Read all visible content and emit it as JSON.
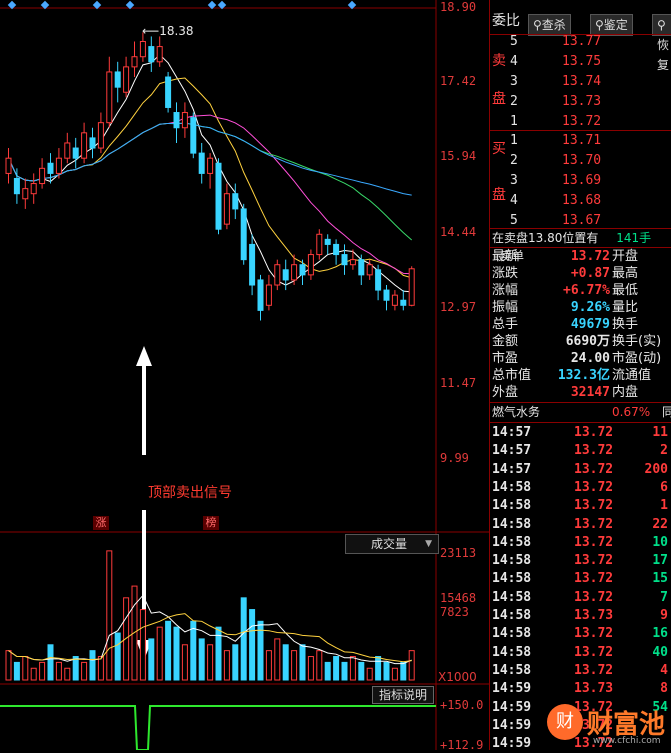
{
  "chart": {
    "price_ticks": [
      "18.90",
      "17.42",
      "15.94",
      "14.44",
      "12.97",
      "11.47",
      "9.99"
    ],
    "high_marker": "18.38",
    "signal_text": "顶部卖出信号",
    "tags": [
      "涨",
      "榜"
    ],
    "volume_dropdown": "成交量",
    "volume_ticks": [
      "23113",
      "15468",
      "7823"
    ],
    "volume_unit": "X1000",
    "indicator_button": "指标说明",
    "indicator_ticks": [
      "+150.0",
      "+112.9"
    ]
  },
  "chart_data": {
    "type": "candlestick",
    "ylim": [
      9.99,
      18.9
    ],
    "candles": [
      {
        "o": 15.6,
        "c": 15.9,
        "h": 16.1,
        "l": 15.4
      },
      {
        "o": 15.5,
        "c": 15.2,
        "h": 15.7,
        "l": 15.0
      },
      {
        "o": 15.1,
        "c": 15.3,
        "h": 15.5,
        "l": 14.9
      },
      {
        "o": 15.2,
        "c": 15.4,
        "h": 15.6,
        "l": 15.0
      },
      {
        "o": 15.4,
        "c": 15.7,
        "h": 15.9,
        "l": 15.3
      },
      {
        "o": 15.8,
        "c": 15.6,
        "h": 16.0,
        "l": 15.4
      },
      {
        "o": 15.6,
        "c": 15.9,
        "h": 16.1,
        "l": 15.5
      },
      {
        "o": 15.9,
        "c": 16.2,
        "h": 16.4,
        "l": 15.8
      },
      {
        "o": 16.1,
        "c": 15.9,
        "h": 16.3,
        "l": 15.7
      },
      {
        "o": 15.9,
        "c": 16.4,
        "h": 16.6,
        "l": 15.8
      },
      {
        "o": 16.3,
        "c": 16.1,
        "h": 16.5,
        "l": 15.9
      },
      {
        "o": 16.1,
        "c": 16.6,
        "h": 16.8,
        "l": 16.0
      },
      {
        "o": 16.6,
        "c": 17.6,
        "h": 17.9,
        "l": 16.5
      },
      {
        "o": 17.6,
        "c": 17.3,
        "h": 17.8,
        "l": 17.0
      },
      {
        "o": 17.2,
        "c": 17.7,
        "h": 17.9,
        "l": 17.1
      },
      {
        "o": 17.7,
        "c": 17.9,
        "h": 18.2,
        "l": 17.5
      },
      {
        "o": 17.9,
        "c": 18.2,
        "h": 18.38,
        "l": 17.8
      },
      {
        "o": 18.1,
        "c": 17.8,
        "h": 18.3,
        "l": 17.6
      },
      {
        "o": 17.8,
        "c": 18.1,
        "h": 18.3,
        "l": 17.7
      },
      {
        "o": 17.5,
        "c": 16.9,
        "h": 17.6,
        "l": 16.8
      },
      {
        "o": 16.8,
        "c": 16.5,
        "h": 17.0,
        "l": 16.2
      },
      {
        "o": 16.5,
        "c": 16.8,
        "h": 17.0,
        "l": 16.3
      },
      {
        "o": 16.7,
        "c": 16.0,
        "h": 16.8,
        "l": 15.9
      },
      {
        "o": 16.0,
        "c": 15.6,
        "h": 16.2,
        "l": 15.4
      },
      {
        "o": 15.6,
        "c": 15.9,
        "h": 16.0,
        "l": 15.3
      },
      {
        "o": 15.8,
        "c": 14.5,
        "h": 15.9,
        "l": 14.4
      },
      {
        "o": 14.6,
        "c": 15.2,
        "h": 15.4,
        "l": 14.5
      },
      {
        "o": 15.2,
        "c": 14.9,
        "h": 15.4,
        "l": 14.7
      },
      {
        "o": 14.9,
        "c": 13.9,
        "h": 15.0,
        "l": 13.8
      },
      {
        "o": 14.2,
        "c": 13.4,
        "h": 14.4,
        "l": 13.2
      },
      {
        "o": 13.5,
        "c": 12.9,
        "h": 13.6,
        "l": 12.7
      },
      {
        "o": 13.0,
        "c": 13.4,
        "h": 13.6,
        "l": 12.9
      },
      {
        "o": 13.4,
        "c": 13.8,
        "h": 13.9,
        "l": 13.3
      },
      {
        "o": 13.7,
        "c": 13.5,
        "h": 13.9,
        "l": 13.3
      },
      {
        "o": 13.5,
        "c": 13.8,
        "h": 14.0,
        "l": 13.4
      },
      {
        "o": 13.8,
        "c": 13.6,
        "h": 13.9,
        "l": 13.4
      },
      {
        "o": 13.6,
        "c": 14.0,
        "h": 14.1,
        "l": 13.5
      },
      {
        "o": 14.0,
        "c": 14.4,
        "h": 14.5,
        "l": 13.9
      },
      {
        "o": 14.3,
        "c": 14.2,
        "h": 14.4,
        "l": 14.0
      },
      {
        "o": 14.2,
        "c": 14.0,
        "h": 14.3,
        "l": 13.8
      },
      {
        "o": 14.0,
        "c": 13.8,
        "h": 14.2,
        "l": 13.6
      },
      {
        "o": 13.8,
        "c": 13.9,
        "h": 14.1,
        "l": 13.7
      },
      {
        "o": 13.9,
        "c": 13.6,
        "h": 14.0,
        "l": 13.4
      },
      {
        "o": 13.6,
        "c": 13.8,
        "h": 13.9,
        "l": 13.5
      },
      {
        "o": 13.7,
        "c": 13.3,
        "h": 13.8,
        "l": 13.1
      },
      {
        "o": 13.3,
        "c": 13.1,
        "h": 13.4,
        "l": 12.9
      },
      {
        "o": 13.0,
        "c": 13.2,
        "h": 13.3,
        "l": 12.9
      },
      {
        "o": 13.1,
        "c": 13.0,
        "h": 13.3,
        "l": 12.9
      },
      {
        "o": 13.0,
        "c": 13.72,
        "h": 13.77,
        "l": 12.98
      }
    ],
    "volumes": [
      5,
      3,
      4,
      2,
      3,
      6,
      3,
      2,
      4,
      3,
      5,
      4,
      22,
      8,
      14,
      16,
      12,
      7,
      9,
      10,
      9,
      6,
      10,
      7,
      6,
      9,
      5,
      6,
      14,
      12,
      10,
      5,
      7,
      6,
      5,
      6,
      4,
      5,
      3,
      4,
      3,
      4,
      3,
      2,
      4,
      3,
      2,
      3,
      5
    ]
  },
  "orderbook": {
    "title": "委比",
    "buttons": [
      "查杀",
      "鉴定",
      "恢复"
    ],
    "sell_label": [
      "卖",
      "盘"
    ],
    "buy_label": [
      "买",
      "盘"
    ],
    "sell": [
      {
        "level": "5",
        "price": "13.77"
      },
      {
        "level": "4",
        "price": "13.75"
      },
      {
        "level": "3",
        "price": "13.74"
      },
      {
        "level": "2",
        "price": "13.73"
      },
      {
        "level": "1",
        "price": "13.72"
      }
    ],
    "buy": [
      {
        "level": "1",
        "price": "13.71"
      },
      {
        "level": "2",
        "price": "13.70"
      },
      {
        "level": "3",
        "price": "13.69"
      },
      {
        "level": "4",
        "price": "13.68"
      },
      {
        "level": "5",
        "price": "13.67"
      }
    ],
    "status_line": {
      "left": "在卖盘13.80位置有",
      "qty": "141手",
      "right": "卖单"
    }
  },
  "quote": [
    {
      "l": "最新",
      "v": "13.72",
      "r": "开盘",
      "vc": "red"
    },
    {
      "l": "涨跌",
      "v": "+0.87",
      "r": "最高",
      "vc": "red"
    },
    {
      "l": "涨幅",
      "v": "+6.77%",
      "r": "最低",
      "vc": "red"
    },
    {
      "l": "振幅",
      "v": "9.26%",
      "r": "量比",
      "vc": "cyan"
    },
    {
      "l": "总手",
      "v": "49679",
      "r": "换手",
      "vc": "cyan"
    },
    {
      "l": "金额",
      "v": "6690万",
      "r": "换手(实)",
      "vc": "white"
    },
    {
      "l": "市盈",
      "v": "24.00",
      "r": "市盈(动)",
      "vc": "white"
    },
    {
      "l": "总市值",
      "v": "132.3亿",
      "r": "流通值",
      "vc": "cyan"
    },
    {
      "l": "外盘",
      "v": "32147",
      "r": "内盘",
      "vc": "red"
    }
  ],
  "sector": {
    "name": "燃气水务",
    "change": "0.67%",
    "suffix": "同"
  },
  "ticks": [
    {
      "t": "14:57",
      "p": "13.72",
      "v": "11",
      "c": "red"
    },
    {
      "t": "14:57",
      "p": "13.72",
      "v": "2",
      "c": "red"
    },
    {
      "t": "14:57",
      "p": "13.72",
      "v": "200",
      "c": "red"
    },
    {
      "t": "14:58",
      "p": "13.72",
      "v": "6",
      "c": "red"
    },
    {
      "t": "14:58",
      "p": "13.72",
      "v": "1",
      "c": "red"
    },
    {
      "t": "14:58",
      "p": "13.72",
      "v": "22",
      "c": "red"
    },
    {
      "t": "14:58",
      "p": "13.72",
      "v": "10",
      "c": "green"
    },
    {
      "t": "14:58",
      "p": "13.72",
      "v": "17",
      "c": "green"
    },
    {
      "t": "14:58",
      "p": "13.72",
      "v": "15",
      "c": "green"
    },
    {
      "t": "14:58",
      "p": "13.72",
      "v": "7",
      "c": "green"
    },
    {
      "t": "14:58",
      "p": "13.73",
      "v": "9",
      "c": "red"
    },
    {
      "t": "14:58",
      "p": "13.72",
      "v": "16",
      "c": "green"
    },
    {
      "t": "14:58",
      "p": "13.72",
      "v": "40",
      "c": "green"
    },
    {
      "t": "14:58",
      "p": "13.72",
      "v": "4",
      "c": "red"
    },
    {
      "t": "14:59",
      "p": "13.73",
      "v": "8",
      "c": "red"
    },
    {
      "t": "14:59",
      "p": "13.72",
      "v": "54",
      "c": "green"
    },
    {
      "t": "14:59",
      "p": "13.72",
      "v": "",
      "c": "red"
    },
    {
      "t": "14:59",
      "p": "13.72",
      "v": "",
      "c": "red"
    }
  ],
  "watermark": {
    "brand": "财富池",
    "url": "www.cfchi.com"
  }
}
